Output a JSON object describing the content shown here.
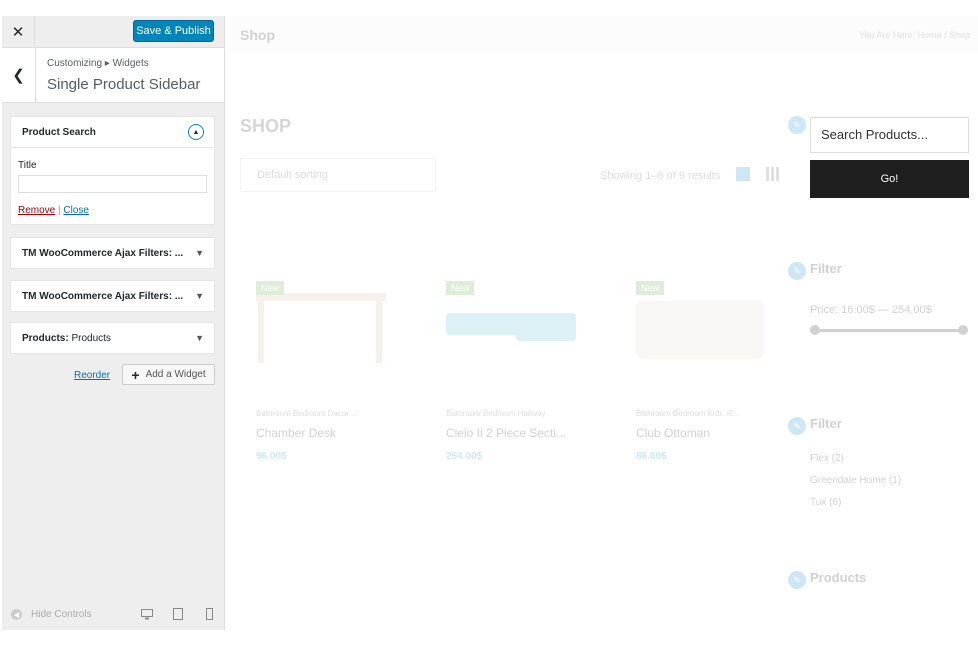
{
  "customizer": {
    "close_icon": "close-icon",
    "save_label": "Save & Publish",
    "back_icon": "chevron-left-icon",
    "breadcrumb": "Customizing ▸ Widgets",
    "section_title": "Single Product Sidebar",
    "widgets": [
      {
        "title": "Product Search",
        "expanded": true,
        "title_field_label": "Title",
        "title_value": "",
        "remove_label": "Remove",
        "separator": "|",
        "close_label": "Close"
      },
      {
        "title": "TM WooCommerce Ajax Filters: ..."
      },
      {
        "title": "TM WooCommerce Ajax Filters: ..."
      },
      {
        "title": "Products:",
        "subtitle": "Products"
      }
    ],
    "reorder_label": "Reorder",
    "add_widget_label": "Add a Widget",
    "hide_controls_label": "Hide Controls",
    "accent_color": "#0085ba"
  },
  "preview": {
    "page_title": "Shop",
    "breadcrumb": "You Are Here:  Home  /  Shop",
    "heading": "SHOP",
    "sorting": "Default sorting",
    "result_count": "Showing 1–6 of 9 results",
    "products": [
      {
        "badge": "New",
        "categories": "Bathroom Bedroom Decor ...",
        "name": "Chamber Desk",
        "price": "96.00$"
      },
      {
        "badge": "New",
        "categories": "Bathroom Bedroom Hallway",
        "name": "Cielo Ii 2 Piece Secti...",
        "price": "254.00$"
      },
      {
        "badge": "New",
        "categories": "Bathroom Bedroom Kids' R...",
        "name": "Club Ottoman",
        "price": "86.00$"
      }
    ],
    "sidebar": {
      "search_placeholder": "Search Products...",
      "go_label": "Go!",
      "filter1_title": "Filter",
      "price_label": "Price: 16.00$ — 254.00$",
      "price_range": [
        16,
        254
      ],
      "filter2_title": "Filter",
      "filter_items": [
        "Flex (2)",
        "Greendale Home (1)",
        "Tux (6)"
      ],
      "products_title": "Products"
    }
  }
}
